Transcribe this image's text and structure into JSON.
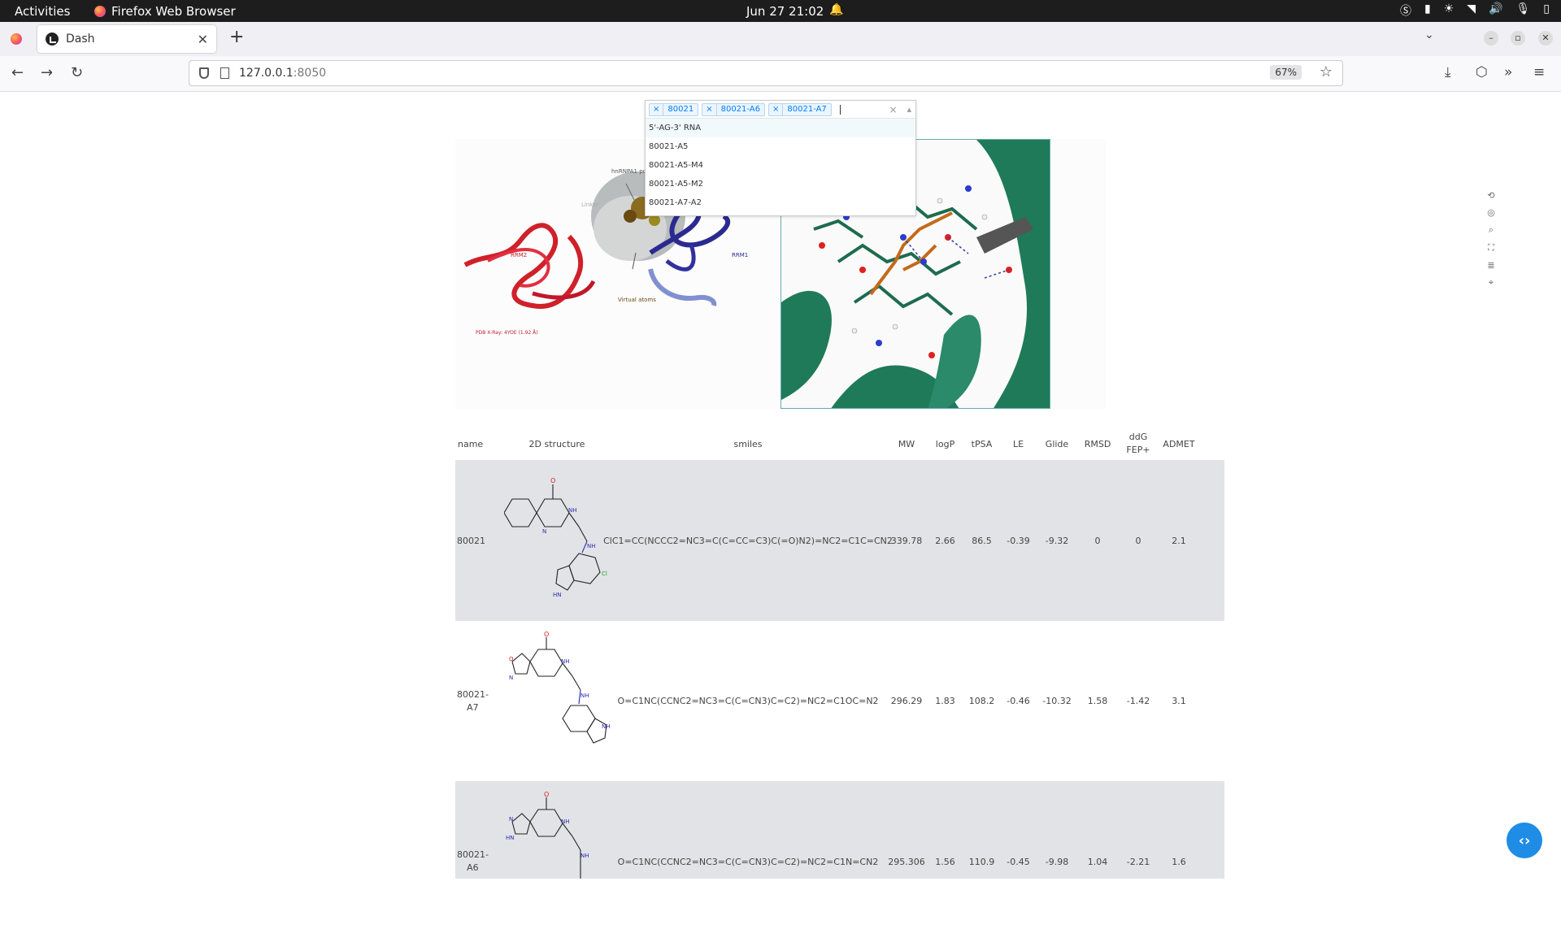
{
  "topbar": {
    "activities": "Activities",
    "app": "Firefox Web Browser",
    "clock": "Jun 27  21:02"
  },
  "browser": {
    "tab_title": "Dash",
    "url_host": "127.0.0.1",
    "url_port": ":8050",
    "zoom": "67%"
  },
  "dropdown": {
    "selected": [
      "80021",
      "80021-A6",
      "80021-A7"
    ],
    "options": [
      "5'-AG-3' RNA",
      "80021-A5",
      "80021-A5-M4",
      "80021-A5-M2",
      "80021-A7-A2"
    ]
  },
  "figure": {
    "labels": {
      "pocket": "hnRNPA1 pocket",
      "linker": "Linker",
      "rrm2": "RRM2",
      "rrm1": "RRM1",
      "virtual": "Virtual atoms",
      "pdb": "PDB X-Ray: 4YOE (1.92 Å)"
    }
  },
  "table": {
    "headers": [
      "name",
      "2D structure",
      "smiles",
      "MW",
      "logP",
      "tPSA",
      "LE",
      "Glide",
      "RMSD",
      "ddG FEP+",
      "ADMET"
    ],
    "rows": [
      {
        "name": "80021",
        "smiles": "ClC1=CC(NCCC2=NC3=C(C=CC=C3)C(=O)N2)=NC2=C1C=CN2",
        "mw": "339.78",
        "logp": "2.66",
        "tpsa": "86.5",
        "le": "-0.39",
        "glide": "-9.32",
        "rmsd": "0",
        "ddg": "0",
        "admet": "2.1"
      },
      {
        "name": "80021-A7",
        "smiles": "O=C1NC(CCNC2=NC3=C(C=CN3)C=C2)=NC2=C1OC=N2",
        "mw": "296.29",
        "logp": "1.83",
        "tpsa": "108.2",
        "le": "-0.46",
        "glide": "-10.32",
        "rmsd": "1.58",
        "ddg": "-1.42",
        "admet": "3.1"
      },
      {
        "name": "80021-A6",
        "smiles": "O=C1NC(CCNC2=NC3=C(C=CN3)C=C2)=NC2=C1N=CN2",
        "mw": "295.306",
        "logp": "1.56",
        "tpsa": "110.9",
        "le": "-0.45",
        "glide": "-9.98",
        "rmsd": "1.04",
        "ddg": "-2.21",
        "admet": "1.6"
      }
    ]
  }
}
